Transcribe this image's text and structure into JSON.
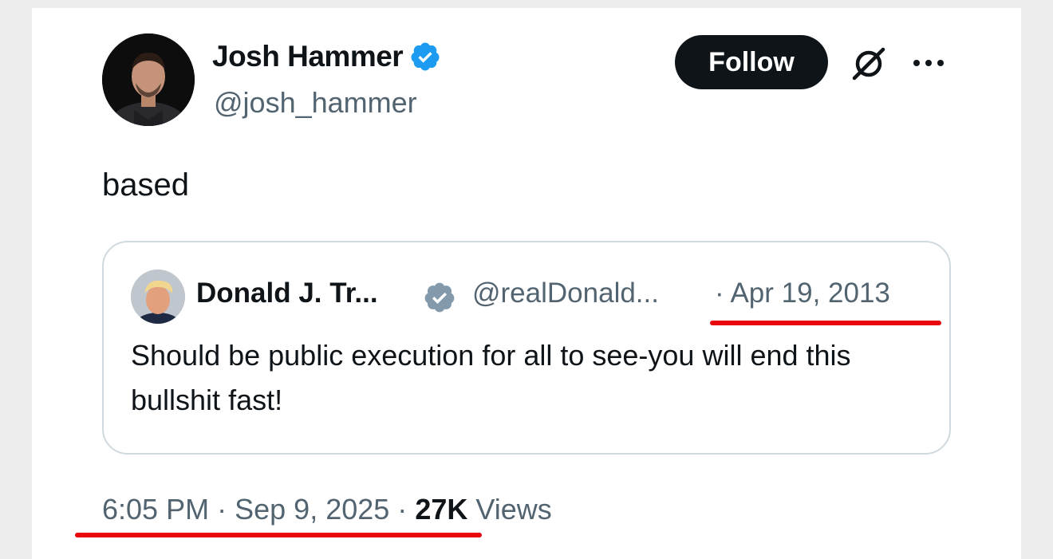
{
  "author": {
    "name": "Josh Hammer",
    "handle": "@josh_hammer",
    "verified_icon": "verified-badge-icon",
    "verified_color": "#1d9bf0"
  },
  "actions": {
    "follow_label": "Follow",
    "grok_icon": "grok-icon",
    "more_icon": "more-icon"
  },
  "tweet": {
    "text": "based"
  },
  "quote": {
    "name": "Donald J. Tr...",
    "handle": "@realDonald...",
    "date": "· Apr 19, 2013",
    "text": "Should be public execution for all to see-you will end this bullshit fast!",
    "verified_color": "#829aab"
  },
  "meta": {
    "time": "6:05 PM",
    "separator": "·",
    "date": "Sep 9, 2025",
    "views_count": "27K",
    "views_label": "Views"
  },
  "annotations": {
    "underline_color": "#e8070d"
  }
}
